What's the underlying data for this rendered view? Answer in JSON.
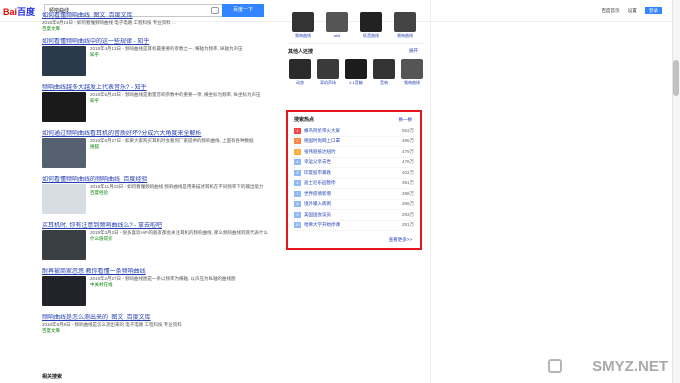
{
  "header": {
    "logo_text": "Bai",
    "logo_accent": "百度",
    "search_value": "频响曲线",
    "search_button": "百度一下",
    "links": [
      "百度首页",
      "设置",
      "登录"
    ]
  },
  "results": [
    {
      "title": "如何看懂频响曲线_图文_百度文库",
      "snippet": "2018年6月14日 - 如何看懂频响曲线 电子电路 工程科技 专业资料 ...",
      "meta": "百度文库",
      "has_thumb": false,
      "thumb_color": ""
    },
    {
      "title": "如何看懂频响曲线中的这一些规律 - 知乎",
      "snippet": "2019年4月13日 - 频响曲线是耳机最重要的参数之一, 横轴为频率, 纵轴为声压",
      "meta": "知乎",
      "has_thumb": true,
      "thumb_color": "#2b3a4a"
    },
    {
      "title": "频响曲线越多大越发上代表音乐? - 知乎",
      "snippet": "2019年5月23日 - 频响曲线是衡量音响参数中的重要一项, 横坐标为频率, 纵坐标为声压",
      "meta": "知乎",
      "has_thumb": true,
      "thumb_color": "#1a1a1a"
    },
    {
      "title": "如何通过频响曲线看耳机的音质好坏?分成六大角度来全解析",
      "snippet": "2019年6月27日 - 如果大家购买耳机时会看到厂家提供的频响曲线, 上面有各种数据",
      "meta": "搜狐",
      "has_thumb": true,
      "thumb_color": "#556070"
    },
    {
      "title": "如何看懂频响曲线的频响曲线_百度经验",
      "snippet": "2019年11月23日 - 如何看懂频响曲线 频响曲线是用来描述耳机在不同频率下的输出能力",
      "meta": "百度经验",
      "has_thumb": true,
      "thumb_color": "#d8dde3"
    },
    {
      "title": "买耳机时, 你有注意到频响曲线么? - 拿去啦吧",
      "snippet": "2019年3月2日 - 很多喜欢HiFi的朋友都会关注耳机的频响曲线, 那么频响曲线到底代表什么",
      "meta": "什么值得买",
      "has_thumb": true,
      "thumb_color": "#3a3f46"
    },
    {
      "title": "耐再被商家忽悠 教你看懂一条频响曲线",
      "snippet": "2019年2月27日 - 频响曲线图是一条以频率为横轴, 以声压为纵轴的曲线图",
      "meta": "中关村在线",
      "has_thumb": true,
      "thumb_color": "#20242a"
    },
    {
      "title": "频响曲线是怎么测出来的_图文_百度文库",
      "snippet": "2018年9月8日 - 频响曲线是怎么测出来的 电子电路 工程科技 专业资料",
      "meta": "百度文库",
      "has_thumb": false,
      "thumb_color": ""
    }
  ],
  "related_label": "相关搜索",
  "right_panel": {
    "images": [
      {
        "label": "频响曲线",
        "color": "#333"
      },
      {
        "label": "ak5",
        "color": "#555"
      },
      {
        "label": "低音曲线",
        "color": "#222"
      },
      {
        "label": "频响曲线",
        "color": "#444"
      }
    ],
    "others_title": "其他人还搜",
    "others_expand": "展开",
    "others": [
      {
        "label": "动态",
        "color": "#2a2a2a"
      },
      {
        "label": "耳机声场",
        "color": "#3a3a3a"
      },
      {
        "label": "2.1音箱",
        "color": "#1c1c1c"
      },
      {
        "label": "音响",
        "color": "#333"
      },
      {
        "label": "频响曲线",
        "color": "#555"
      }
    ]
  },
  "hot": {
    "title": "搜索热点",
    "refresh": "换一换",
    "more": "查看更多>>",
    "items": [
      {
        "rank": "1",
        "keyword": "蜂鸟阿伦带火大屏",
        "count": "553万"
      },
      {
        "rank": "2",
        "keyword": "德国时尚网上口罩",
        "count": "496万"
      },
      {
        "rank": "3",
        "keyword": "张伟丽抵达纽约",
        "count": "479万"
      },
      {
        "rank": "4",
        "keyword": "幸运父亲去世",
        "count": "476万"
      },
      {
        "rank": "5",
        "keyword": "印度股市暴跌",
        "count": "402万"
      },
      {
        "rank": "6",
        "keyword": "迪士尼乐园暂停",
        "count": "391万"
      },
      {
        "rank": "7",
        "keyword": "世界疫情新增",
        "count": "388万"
      },
      {
        "rank": "8",
        "keyword": "境外输入病例",
        "count": "285万"
      },
      {
        "rank": "9",
        "keyword": "美国国会议员",
        "count": "283万"
      },
      {
        "rank": "10",
        "keyword": "哈佛大学开始停课",
        "count": "281万"
      }
    ]
  },
  "watermark": "SMYZ.NET"
}
